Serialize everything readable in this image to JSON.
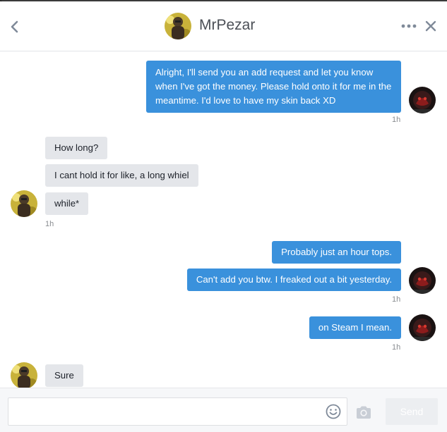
{
  "header": {
    "back_icon": "chevron-left-icon",
    "contact_name": "MrPezar",
    "more_icon": "ellipsis-icon",
    "close_icon": "close-icon"
  },
  "messages": [
    {
      "direction": "outgoing",
      "text": "Alright, I'll send you an add request and let you know when I've got the money. Please hold onto it for me in the meantime. I'd love to have my skin back XD",
      "time": "1h"
    },
    {
      "direction": "incoming",
      "text": "How long?"
    },
    {
      "direction": "incoming",
      "text": "I cant hold it for like, a long  whiel"
    },
    {
      "direction": "incoming",
      "text": "while*",
      "time": "1h"
    },
    {
      "direction": "outgoing",
      "text": "Probably just an hour tops."
    },
    {
      "direction": "outgoing",
      "text": "Can't add you btw. I freaked out a bit yesterday.",
      "time": "1h"
    },
    {
      "direction": "outgoing",
      "text": "on Steam I mean.",
      "time": "1h"
    },
    {
      "direction": "incoming",
      "text": "Sure"
    }
  ],
  "composer": {
    "placeholder": "",
    "emoji_icon": "smiley-icon",
    "camera_icon": "camera-icon",
    "send_label": "Send"
  },
  "colors": {
    "outgoing_bubble": "#3a91dc",
    "incoming_bubble": "#e4e6ea",
    "header_text": "#4b4f56",
    "timestamp": "#8a8d91"
  }
}
